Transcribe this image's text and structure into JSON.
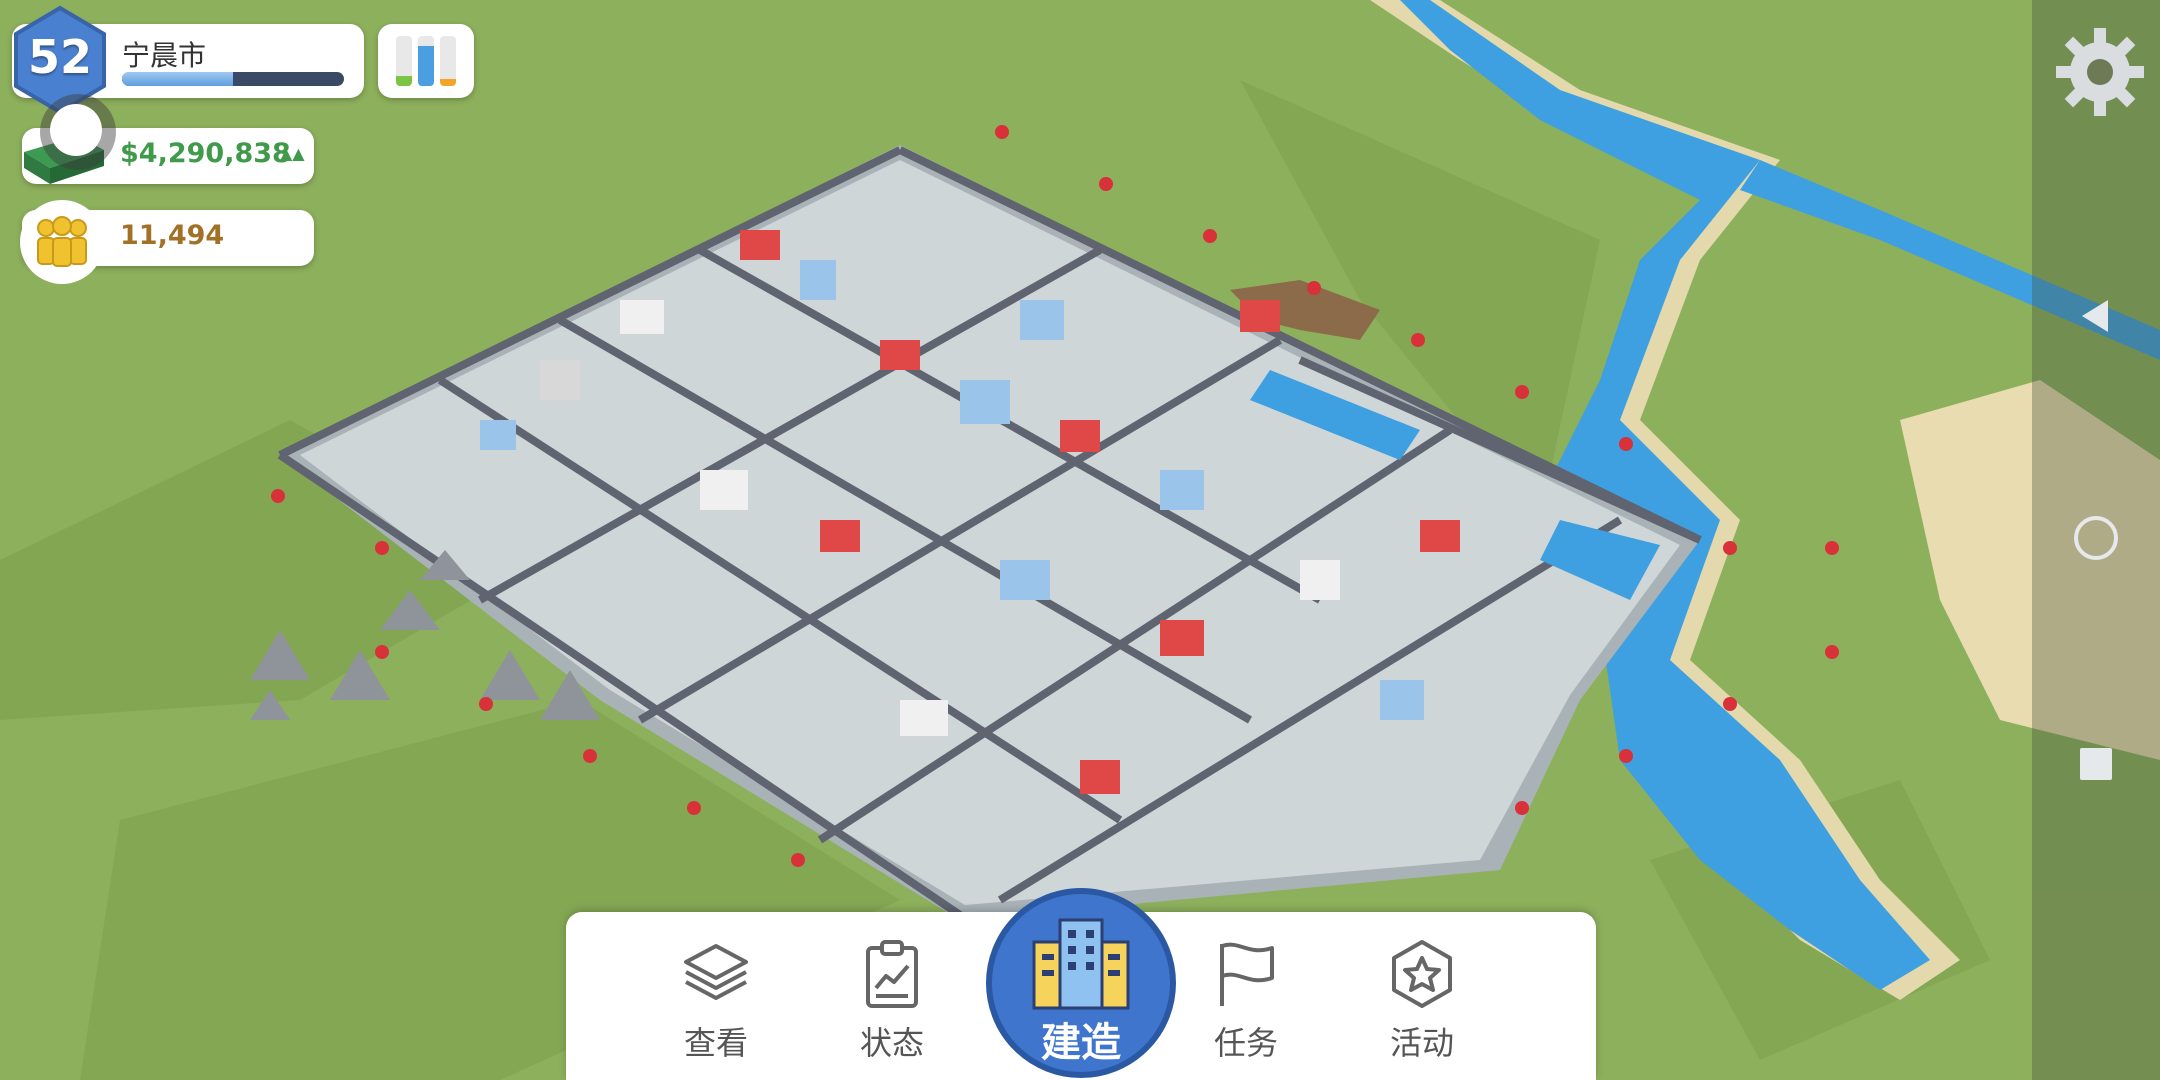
{
  "city": {
    "level": "52",
    "name": "宁晨市",
    "xp_progress": 0.5
  },
  "economy": {
    "money": "$4,290,838",
    "money_trend": "▲▲"
  },
  "population": {
    "value": "11,494"
  },
  "stats_meter": {
    "bars": [
      {
        "level": 0.2,
        "color": "#7cc443"
      },
      {
        "level": 0.8,
        "color": "#4b9fe0"
      },
      {
        "level": 0.15,
        "color": "#f2a629"
      }
    ]
  },
  "icons": {
    "level": "hexagon-badge-icon",
    "stats": "bar-meter-icon",
    "money": "money-stack-icon",
    "population": "people-icon",
    "settings": "gear-icon",
    "joystick": "joystick-icon"
  },
  "toolbar": {
    "view_label": "查看",
    "status_label": "状态",
    "build_label": "建造",
    "tasks_label": "任务",
    "events_label": "活动"
  },
  "system_nav": {
    "back": "back-triangle-icon",
    "home": "home-circle-icon",
    "recents": "recents-square-icon"
  },
  "colors": {
    "grass": "#8db05c",
    "river": "#3ea0e0",
    "road": "#5f6470",
    "build_button": "#3f75cc",
    "money_text": "#3f9a4a",
    "population_text": "#a27128"
  }
}
